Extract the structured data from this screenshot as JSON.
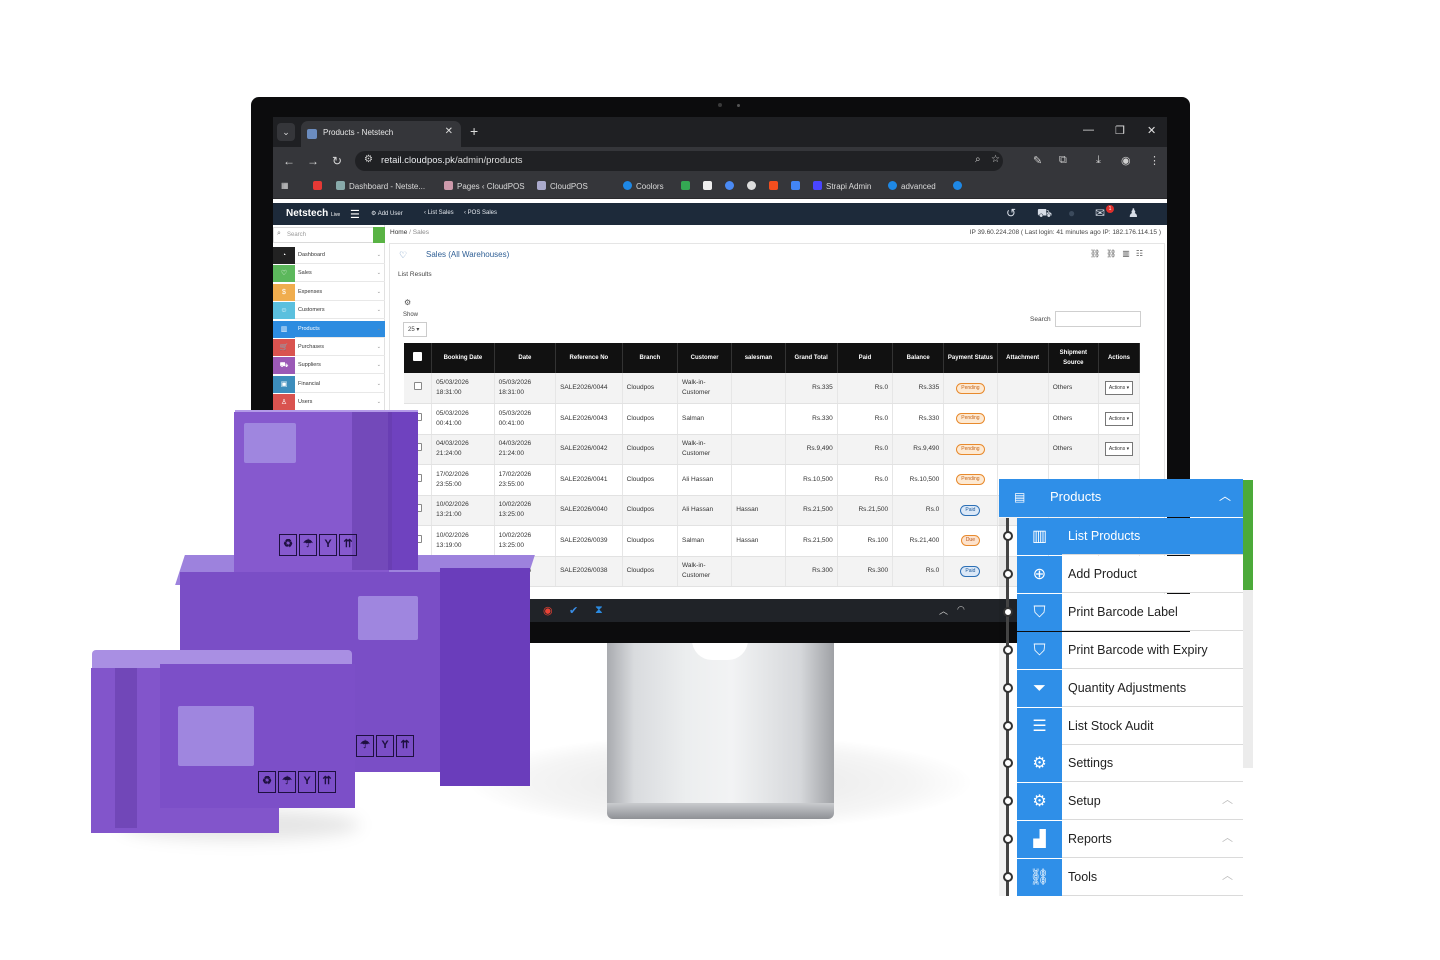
{
  "browser": {
    "tab_title": "Products - Netstech",
    "url_host": "retail.cloudpos.pk",
    "url_path": "/admin/products",
    "bookmarks": [
      "Dashboard - Netste...",
      "Pages ‹ CloudPOS",
      "CloudPOS",
      "Coolors",
      "Strapi Admin",
      "advanced"
    ]
  },
  "app": {
    "brand": "Netstech",
    "brand_suffix": "Live",
    "header_links": [
      "Add User",
      "List Sales",
      "POS Sales"
    ],
    "mail_count": "1"
  },
  "sidebar": {
    "search_placeholder": "Search",
    "items": [
      {
        "label": "Dashboard",
        "color": "#222222",
        "icon": "dashboard-icon"
      },
      {
        "label": "Sales",
        "color": "#5cb85c",
        "icon": "heart-icon"
      },
      {
        "label": "Expenses",
        "color": "#f0ad4e",
        "icon": "money-icon"
      },
      {
        "label": "Customers",
        "color": "#5bc0de",
        "icon": "users-icon"
      },
      {
        "label": "Products",
        "color": "#2d8ce0",
        "icon": "barcode-icon"
      },
      {
        "label": "Purchases",
        "color": "#d9534f",
        "icon": "cart-icon"
      },
      {
        "label": "Suppliers",
        "color": "#9b59b6",
        "icon": "truck-icon"
      },
      {
        "label": "Financial",
        "color": "#3c8dbc",
        "icon": "bank-icon"
      },
      {
        "label": "Users",
        "color": "#d9534f",
        "icon": "user-icon"
      }
    ]
  },
  "breadcrumb": {
    "home": "Home",
    "current": "Sales"
  },
  "ip_info": "IP 39.60.224.208 ( Last login: 41 minutes ago IP: 182.176.114.15 )",
  "panel": {
    "title": "Sales (All Warehouses)",
    "list_results": "List Results",
    "show_label": "Show",
    "show_value": "25",
    "search_label": "Search"
  },
  "table": {
    "headers": [
      "Booking Date",
      "Date",
      "Reference No",
      "Branch",
      "Customer",
      "salesman",
      "Grand Total",
      "Paid",
      "Balance",
      "Payment Status",
      "Attachment",
      "Shipment Source",
      "Actions"
    ],
    "rows": [
      {
        "booking_date": "05/03/2026 18:31:00",
        "date": "05/03/2026 18:31:00",
        "ref": "SALE2026/0044",
        "branch": "Cloudpos",
        "customer": "Walk-in-Customer",
        "salesman": "",
        "grand_total": "Rs.335",
        "paid": "Rs.0",
        "balance": "Rs.335",
        "status": "Pending",
        "attachment": "",
        "shipment": "Others",
        "action": "Actions ▾"
      },
      {
        "booking_date": "05/03/2026 00:41:00",
        "date": "05/03/2026 00:41:00",
        "ref": "SALE2026/0043",
        "branch": "Cloudpos",
        "customer": "Salman",
        "salesman": "",
        "grand_total": "Rs.330",
        "paid": "Rs.0",
        "balance": "Rs.330",
        "status": "Pending",
        "attachment": "",
        "shipment": "Others",
        "action": "Actions ▾"
      },
      {
        "booking_date": "04/03/2026 21:24:00",
        "date": "04/03/2026 21:24:00",
        "ref": "SALE2026/0042",
        "branch": "Cloudpos",
        "customer": "Walk-in-Customer",
        "salesman": "",
        "grand_total": "Rs.9,490",
        "paid": "Rs.0",
        "balance": "Rs.9,490",
        "status": "Pending",
        "attachment": "",
        "shipment": "Others",
        "action": "Actions ▾"
      },
      {
        "booking_date": "17/02/2026 23:55:00",
        "date": "17/02/2026 23:55:00",
        "ref": "SALE2026/0041",
        "branch": "Cloudpos",
        "customer": "Ali Hassan",
        "salesman": "",
        "grand_total": "Rs.10,500",
        "paid": "Rs.0",
        "balance": "Rs.10,500",
        "status": "Pending",
        "attachment": "",
        "shipment": "",
        "action": ""
      },
      {
        "booking_date": "10/02/2026 13:21:00",
        "date": "10/02/2026 13:25:00",
        "ref": "SALE2026/0040",
        "branch": "Cloudpos",
        "customer": "Ali Hassan",
        "salesman": "Hassan",
        "grand_total": "Rs.21,500",
        "paid": "Rs.21,500",
        "balance": "Rs.0",
        "status": "Paid",
        "attachment": "",
        "shipment": "",
        "action": ""
      },
      {
        "booking_date": "10/02/2026 13:19:00",
        "date": "10/02/2026 13:25:00",
        "ref": "SALE2026/0039",
        "branch": "Cloudpos",
        "customer": "Salman",
        "salesman": "Hassan",
        "grand_total": "Rs.21,500",
        "paid": "Rs.100",
        "balance": "Rs.21,400",
        "status": "Due",
        "attachment": "",
        "shipment": "",
        "action": ""
      },
      {
        "booking_date": "",
        "date": "10/02/2026",
        "ref": "SALE2026/0038",
        "branch": "Cloudpos",
        "customer": "Walk-in-Customer",
        "salesman": "",
        "grand_total": "Rs.300",
        "paid": "Rs.300",
        "balance": "Rs.0",
        "status": "Paid",
        "attachment": "",
        "shipment": "",
        "action": ""
      }
    ]
  },
  "products_menu": {
    "title": "Products",
    "items": [
      {
        "label": "List Products",
        "icon": "barcode-icon",
        "active": true
      },
      {
        "label": "Add Product",
        "icon": "plus-circle-icon",
        "active": false
      },
      {
        "label": "Print Barcode Label",
        "icon": "tag-icon",
        "active": false
      },
      {
        "label": "Print Barcode with Expiry",
        "icon": "tag-icon",
        "active": false
      },
      {
        "label": "Quantity Adjustments",
        "icon": "filter-icon",
        "active": false
      },
      {
        "label": "List Stock Audit",
        "icon": "list-icon",
        "active": false
      },
      {
        "label": "Settings",
        "icon": "gear-icon",
        "active": false
      },
      {
        "label": "Setup",
        "icon": "gear-icon",
        "active": false
      },
      {
        "label": "Reports",
        "icon": "bar-chart-icon",
        "active": false
      },
      {
        "label": "Tools",
        "icon": "link-icon",
        "active": false
      }
    ]
  },
  "colors": {
    "menu_blue": "#2f8fe8",
    "box_purple": "#7e53c9",
    "header_dark": "#1d2a3a"
  }
}
